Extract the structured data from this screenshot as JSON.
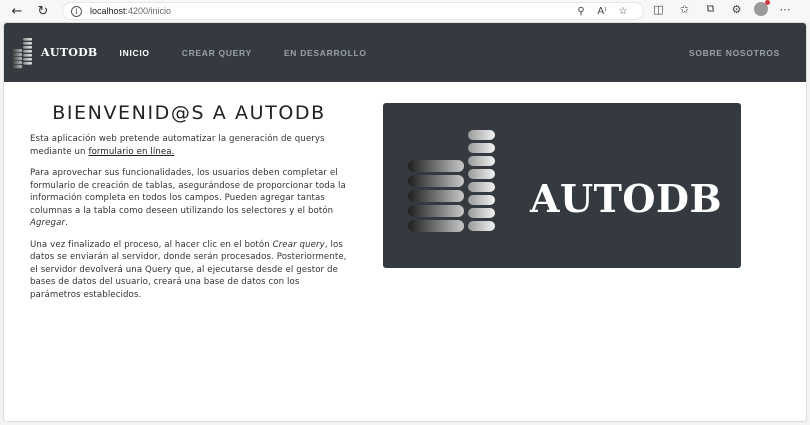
{
  "browser": {
    "url_host": "localhost",
    "url_path": ":4200/inicio",
    "back_icon": "arrow-left-icon",
    "reload_icon": "reload-icon",
    "info_icon": "info-icon"
  },
  "navbar": {
    "brand": "AUTODB",
    "links": [
      {
        "label": "INICIO",
        "active": true
      },
      {
        "label": "CREAR QUERY",
        "active": false
      },
      {
        "label": "EN DESARROLLO",
        "active": false
      }
    ],
    "right_link": "SOBRE NOSOTROS",
    "background": "#343a40"
  },
  "main": {
    "title": "BIENVENID@S A AUTODB",
    "p1_before": "Esta aplicación web pretende automatizar la generación de querys mediante un ",
    "p1_link": "formulario en línea.",
    "p2_before": "Para aprovechar sus funcionalidades, los usuarios deben completar el formulario de creación de tablas, asegurándose de proporcionar toda la información completa en todos los campos. Pueden agregar tantas columnas a la tabla como deseen utilizando los selectores y el botón ",
    "p2_em": "Agregar",
    "p2_after": ".",
    "p3_before": "Una vez finalizado el proceso, al hacer clic en el botón ",
    "p3_em": "Crear query",
    "p3_after": ", los datos se enviarán al servidor, donde serán procesados. Posteriormente, el servidor devolverá una Query que, al ejecutarse desde el gestor de bases de datos del usuario, creará una base de datos con los parámetros establecidos.",
    "hero_text": "AUTODB"
  }
}
